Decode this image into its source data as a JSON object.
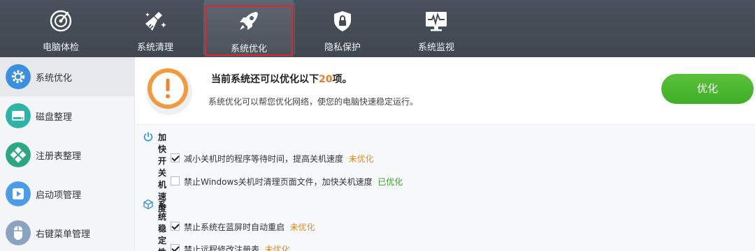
{
  "nav": {
    "tabs": [
      {
        "label": "电脑体检",
        "icon": "radar-icon"
      },
      {
        "label": "系统清理",
        "icon": "broom-icon"
      },
      {
        "label": "系统优化",
        "icon": "rocket-icon",
        "active": true
      },
      {
        "label": "隐私保护",
        "icon": "shield-lock-icon"
      },
      {
        "label": "系统监视",
        "icon": "monitor-pulse-icon"
      }
    ]
  },
  "sidebar": {
    "items": [
      {
        "label": "系统优化",
        "icon": "gear-icon",
        "color": "#3b8fe0",
        "active": true
      },
      {
        "label": "磁盘整理",
        "icon": "disk-icon",
        "color": "#2bb5a8"
      },
      {
        "label": "注册表整理",
        "icon": "registry-icon",
        "color": "#2aa880"
      },
      {
        "label": "启动项管理",
        "icon": "play-icon",
        "color": "#4a9ce8"
      },
      {
        "label": "右键菜单管理",
        "icon": "mouse-icon",
        "color": "#8aa3bf"
      }
    ]
  },
  "header": {
    "headline_prefix": "当前系统还可以优化以下",
    "headline_count": "20",
    "headline_suffix": "项。",
    "subline": "系统优化可以帮您优化网络，使您的电脑快速稳定运行。",
    "button_label": "优化"
  },
  "sections": [
    {
      "title": "加快开关机速度",
      "icon": "power-icon",
      "rows": [
        {
          "label": "减小关机时的程序等待时间，提高关机速度",
          "status": "未优化",
          "checked": true
        },
        {
          "label": "禁止Windows关机时清理页面文件，加快关机速度",
          "status": "已优化",
          "checked": false
        }
      ]
    },
    {
      "title": "系统稳定性",
      "icon": "cube-icon",
      "rows": [
        {
          "label": "禁止系统在蓝屏时自动重启",
          "status": "未优化",
          "checked": true
        },
        {
          "label": "禁止远程修改注册表",
          "status": "未优化",
          "checked": true
        }
      ]
    }
  ],
  "colors": {
    "topbar": "#444c55",
    "active_frame": "#e0262a",
    "accent_orange": "#f07a2c",
    "ok_green": "#35a524",
    "button_green": "#4bb530"
  }
}
